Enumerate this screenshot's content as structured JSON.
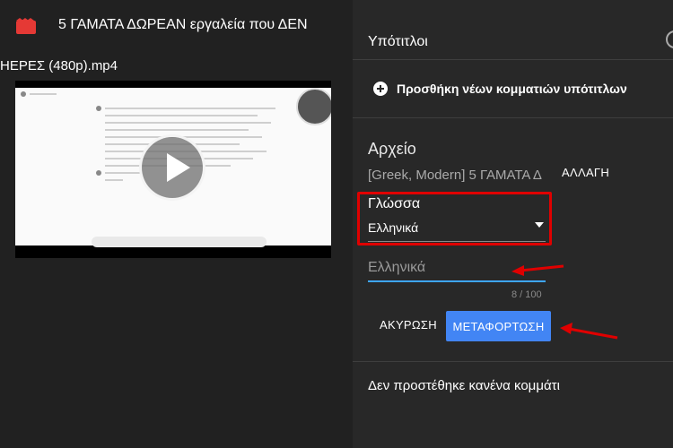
{
  "video": {
    "title": "5 ΓΑΜΑΤΑ ΔΩΡΕΑΝ εργαλεία που ΔΕΝ",
    "file_name": "ΗΕΡΕΣ (480p).mp4",
    "icon": "film-clapper-icon"
  },
  "panel": {
    "title": "Υπότιτλοι",
    "add_label": "Προσθήκη νέων κομματιών υπότιτλων",
    "file_label": "Αρχείο",
    "file_value": "[Greek, Modern] 5 ΓΑΜΑΤΑ Δ",
    "change_label": "ΑΛΛΑΓΗ",
    "language_label": "Γλώσσα",
    "language_value": "Ελληνικά",
    "name_placeholder": "Ελληνικά",
    "counter": "8 / 100",
    "cancel_label": "ΑΚΥΡΩΣΗ",
    "upload_label": "ΜΕΤΑΦΟΡΤΩΣΗ",
    "empty_message": "Δεν προστέθηκε κανένα κομμάτι"
  },
  "colors": {
    "panel_bg": "#282828",
    "accent_blue": "#4285f4",
    "annotation_red": "#e00000"
  }
}
